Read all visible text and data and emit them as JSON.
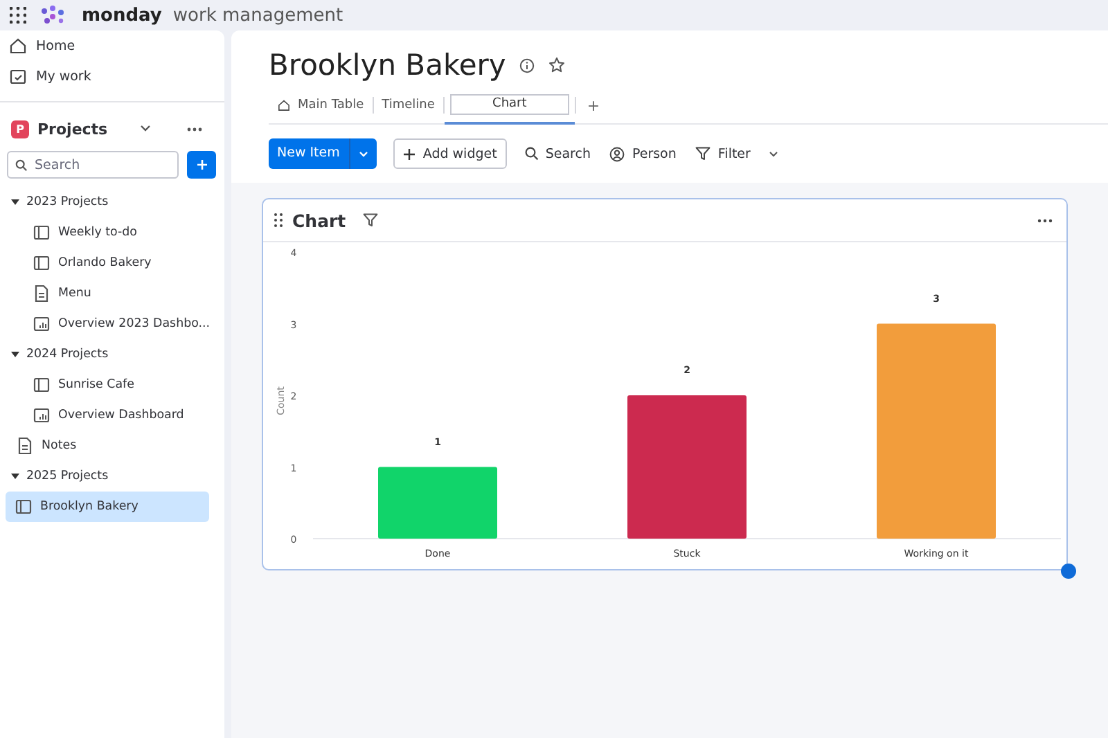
{
  "topbar": {
    "product": "monday",
    "product_suffix": "work management"
  },
  "sidebar": {
    "nav": [
      {
        "label": "Home",
        "kind": "home"
      },
      {
        "label": "My work",
        "kind": "calendar"
      }
    ],
    "workspace": {
      "badge": "P",
      "name": "Projects"
    },
    "search": {
      "placeholder": "Search"
    },
    "items": [
      {
        "label": "2023 Projects",
        "kind": "folder",
        "expanded": true,
        "selected": false,
        "children": [
          {
            "label": "Weekly to-do",
            "kind": "board",
            "selected": false
          },
          {
            "label": "Orlando Bakery",
            "kind": "board",
            "selected": false
          },
          {
            "label": "Menu",
            "kind": "doc",
            "selected": false
          },
          {
            "label": "Overview 2023 Dashbo...",
            "kind": "dashboard",
            "selected": false
          }
        ]
      },
      {
        "label": "2024 Projects",
        "kind": "folder",
        "expanded": true,
        "selected": false,
        "children": [
          {
            "label": "Sunrise Cafe",
            "kind": "board",
            "selected": false
          },
          {
            "label": "Overview Dashboard",
            "kind": "dashboard",
            "selected": false
          }
        ]
      },
      {
        "label": "Notes",
        "kind": "doc",
        "selected": false
      },
      {
        "label": "2025 Projects",
        "kind": "folder",
        "expanded": true,
        "selected": false,
        "children": [
          {
            "label": "Brooklyn Bakery",
            "kind": "board",
            "selected": true
          }
        ]
      }
    ]
  },
  "board": {
    "title": "Brooklyn Bakery",
    "tabs": [
      {
        "label": "Main Table",
        "selected": false,
        "kind": "home"
      },
      {
        "label": "Timeline",
        "selected": false,
        "kind": "plain"
      },
      {
        "label": "Chart",
        "selected": true,
        "kind": "plain"
      }
    ],
    "add_tab": "+",
    "toolbar": {
      "new_item": "New Item",
      "add_widget": "Add widget",
      "search": "Search",
      "person": "Person",
      "filter": "Filter"
    }
  },
  "widget": {
    "title": "Chart",
    "chart_data": {
      "type": "bar",
      "ylabel": "Count",
      "categories": [
        "Done",
        "Stuck",
        "Working on it"
      ],
      "series": [
        {
          "values": [
            1,
            2,
            3
          ]
        }
      ],
      "colors": [
        "#11d46a",
        "#cc2a4f",
        "#f29d3c"
      ],
      "ylim": [
        0,
        4
      ],
      "yticks": [
        0,
        1,
        2,
        3,
        4
      ],
      "data_labels": true
    }
  }
}
